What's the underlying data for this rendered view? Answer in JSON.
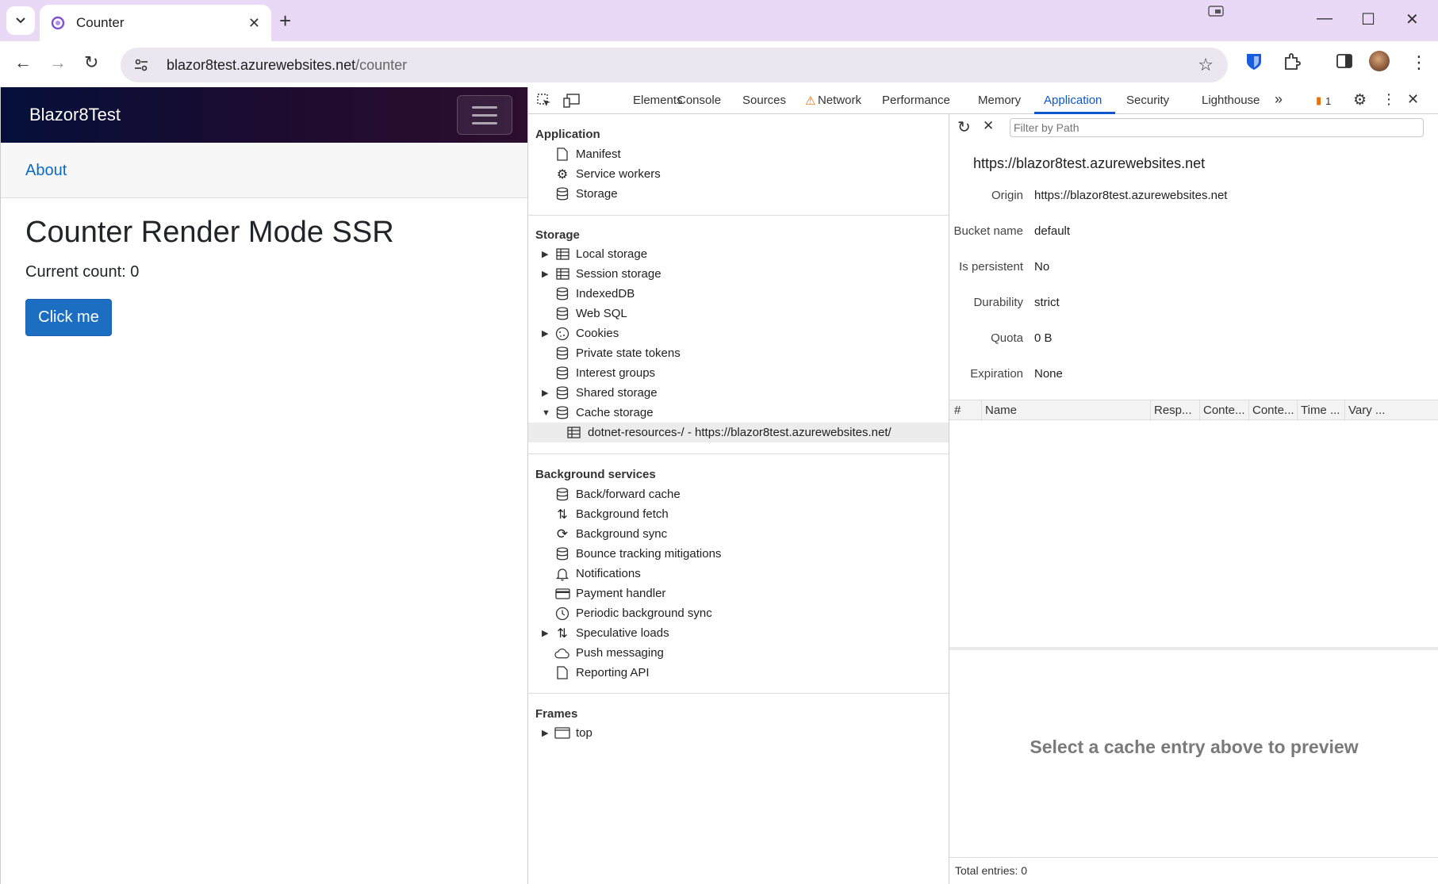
{
  "browser": {
    "tab_title": "Counter",
    "url_host": "blazor8test.azurewebsites.net",
    "url_path": "/counter"
  },
  "page": {
    "brand": "Blazor8Test",
    "about_link": "About",
    "heading": "Counter Render Mode SSR",
    "current_count": "Current count: 0",
    "button_label": "Click me"
  },
  "devtools": {
    "tabs": [
      "Elements",
      "Console",
      "Sources",
      "Network",
      "Performance",
      "Memory",
      "Application",
      "Security",
      "Lighthouse"
    ],
    "active_tab": "Application",
    "issues_count": "1",
    "sections": {
      "application": {
        "title": "Application",
        "items": [
          "Manifest",
          "Service workers",
          "Storage"
        ]
      },
      "storage": {
        "title": "Storage",
        "items": [
          "Local storage",
          "Session storage",
          "IndexedDB",
          "Web SQL",
          "Cookies",
          "Private state tokens",
          "Interest groups",
          "Shared storage",
          "Cache storage"
        ],
        "cache_child": "dotnet-resources-/ - https://blazor8test.azurewebsites.net/"
      },
      "background": {
        "title": "Background services",
        "items": [
          "Back/forward cache",
          "Background fetch",
          "Background sync",
          "Bounce tracking mitigations",
          "Notifications",
          "Payment handler",
          "Periodic background sync",
          "Speculative loads",
          "Push messaging",
          "Reporting API"
        ]
      },
      "frames": {
        "title": "Frames",
        "items": [
          "top"
        ]
      }
    },
    "cache": {
      "filter_placeholder": "Filter by Path",
      "origin_title": "https://blazor8test.azurewebsites.net",
      "details": {
        "origin_key": "Origin",
        "origin_val": "https://blazor8test.azurewebsites.net",
        "bucket_key": "Bucket name",
        "bucket_val": "default",
        "persistent_key": "Is persistent",
        "persistent_val": "No",
        "durability_key": "Durability",
        "durability_val": "strict",
        "quota_key": "Quota",
        "quota_val": "0 B",
        "expiration_key": "Expiration",
        "expiration_val": "None"
      },
      "columns": [
        "#",
        "Name",
        "Resp...",
        "Conte...",
        "Conte...",
        "Time ...",
        "Vary ..."
      ],
      "preview_message": "Select a cache entry above to preview",
      "total_entries": "Total entries: 0"
    }
  },
  "colors": {
    "titlebar": "#e9d9f7",
    "accent": "#0b57d0",
    "button": "#1b6ec2"
  }
}
